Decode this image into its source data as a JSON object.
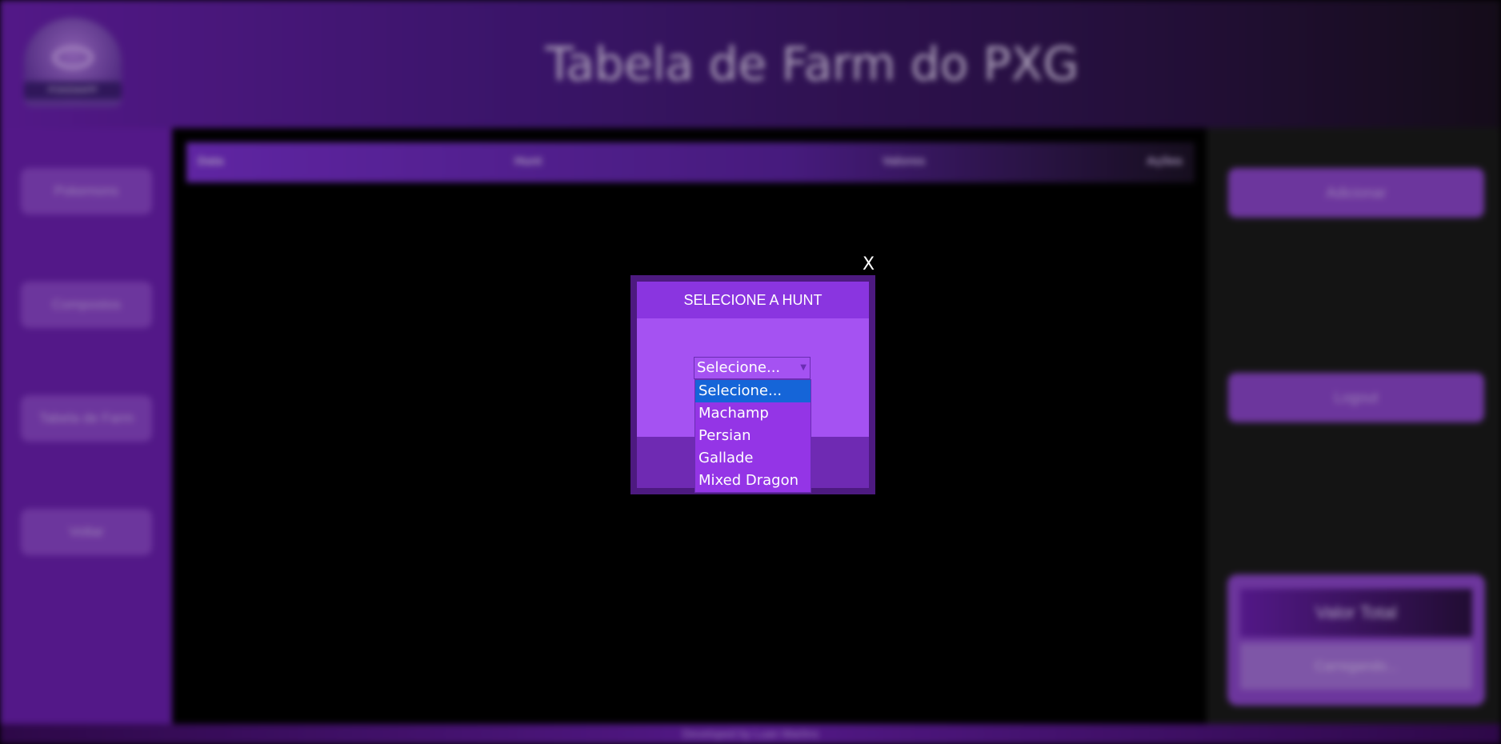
{
  "header": {
    "title": "Tabela de Farm do PXG",
    "logo_text": "POKEMAPP"
  },
  "sidebar": {
    "items": [
      {
        "label": "Pokemons"
      },
      {
        "label": "Compostos"
      },
      {
        "label": "Tabela de Farm"
      },
      {
        "label": "Voltar"
      }
    ]
  },
  "table": {
    "columns": [
      "Data",
      "Hunt",
      "Valores",
      "Ações"
    ]
  },
  "right_panel": {
    "add_label": "Adicionar",
    "logout_label": "Logout",
    "total_title": "Valor Total",
    "total_value": "Carregando..."
  },
  "footer": {
    "text": "Developed by Luan Martins"
  },
  "modal": {
    "close_label": "X",
    "title": "SELECIONE A HUNT",
    "select_value": "Selecione...",
    "options": [
      "Selecione...",
      "Machamp",
      "Persian",
      "Gallade",
      "Mixed Dragon"
    ],
    "selected_index": 0
  },
  "colors": {
    "accent": "#8a35e0",
    "selected_option": "#1565d8"
  }
}
